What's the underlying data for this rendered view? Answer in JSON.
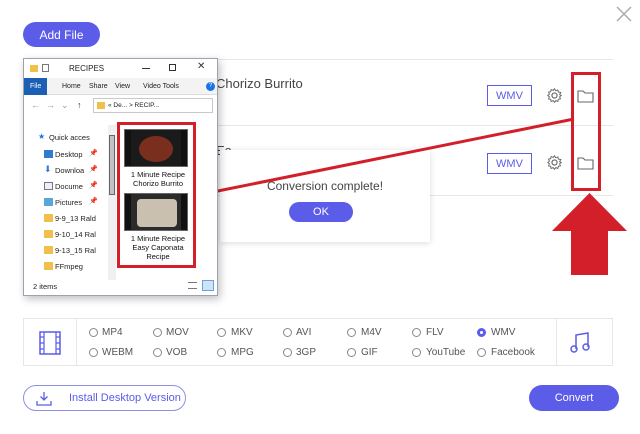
{
  "toolbar": {
    "add_file_label": "Add File"
  },
  "files": [
    {
      "name": "Chorizo Burrito",
      "format": "WMV"
    },
    {
      "name": "Ea",
      "format": "WMV"
    }
  ],
  "dialog": {
    "message": "Conversion complete!",
    "ok_label": "OK"
  },
  "explorer": {
    "title": "RECIPES",
    "ribbon": [
      "File",
      "Home",
      "Share",
      "View",
      "Video Tools"
    ],
    "address": "« De... > RECIP...",
    "nav_items": [
      {
        "label": "Quick access",
        "icon": "star-icon"
      },
      {
        "label": "Desktop",
        "icon": "desktop-icon",
        "pinned": true
      },
      {
        "label": "Downloa",
        "icon": "download-icon",
        "pinned": true
      },
      {
        "label": "Docume",
        "icon": "document-icon",
        "pinned": true
      },
      {
        "label": "Pictures",
        "icon": "picture-icon",
        "pinned": true
      },
      {
        "label": "9-9_13 Rald",
        "icon": "folder-icon"
      },
      {
        "label": "9-10_14 Ralc",
        "icon": "folder-icon"
      },
      {
        "label": "9-13_15 Rald",
        "icon": "folder-icon"
      },
      {
        "label": "FFmpeg",
        "icon": "folder-icon"
      }
    ],
    "files": [
      {
        "caption_1": "1 Minute Recipe",
        "caption_2": "Chorizo Burrito"
      },
      {
        "caption_1": "1 Minute Recipe",
        "caption_2": "Easy Caponata",
        "caption_3": "Recipe"
      }
    ],
    "status": "2 items"
  },
  "formats": {
    "row1": [
      "MP4",
      "MOV",
      "MKV",
      "AVI",
      "M4V",
      "FLV",
      "WMV"
    ],
    "row2": [
      "WEBM",
      "VOB",
      "MPG",
      "3GP",
      "GIF",
      "YouTube",
      "Facebook"
    ],
    "selected": "WMV"
  },
  "footer": {
    "install_label": "Install Desktop Version",
    "convert_label": "Convert"
  },
  "colors": {
    "accent": "#5b5ce8",
    "annotation_red": "#d21f2a"
  }
}
